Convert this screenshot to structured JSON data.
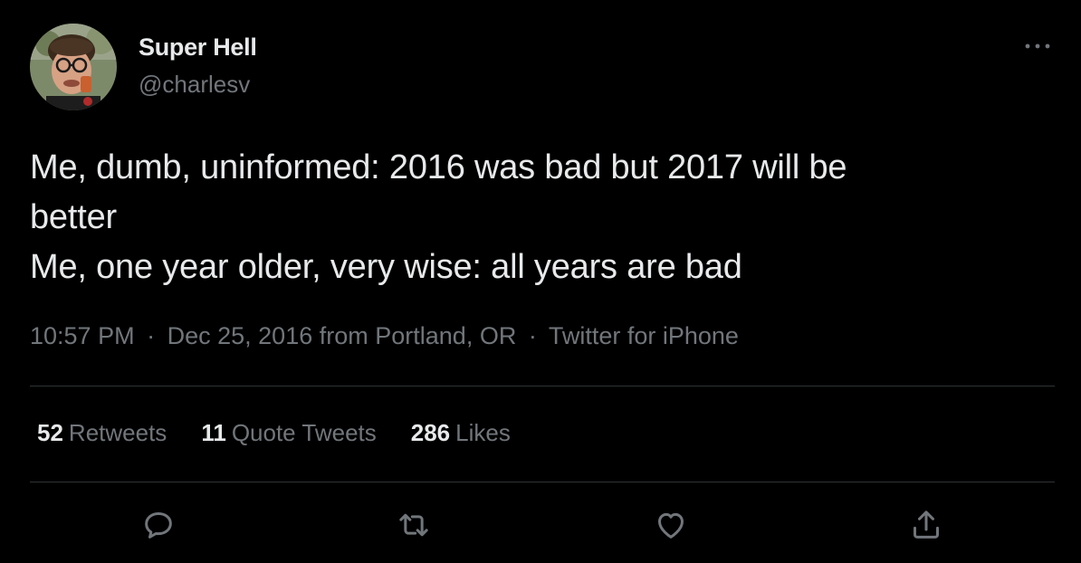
{
  "author": {
    "display_name": "Super Hell",
    "handle": "@charlesv"
  },
  "tweet": {
    "lines": [
      "Me, dumb, uninformed: 2016 was bad but 2017 will be",
      "better",
      "Me, one year older, very wise: all years are bad"
    ]
  },
  "meta": {
    "time": "10:57 PM",
    "separator": "·",
    "date": "Dec 25, 2016",
    "location": "from Portland, OR",
    "client": "Twitter for iPhone"
  },
  "stats": {
    "retweets": {
      "count": "52",
      "label": "Retweets"
    },
    "quotes": {
      "count": "11",
      "label": "Quote Tweets"
    },
    "likes": {
      "count": "286",
      "label": "Likes"
    }
  },
  "icons": {
    "more": "more-horizontal-icon",
    "reply": "reply-icon",
    "retweet": "retweet-icon",
    "like": "heart-icon",
    "share": "share-icon"
  },
  "colors": {
    "background": "#000000",
    "primary_text": "#e7e9ea",
    "secondary_text": "#71767b",
    "divider": "#2f3336"
  }
}
